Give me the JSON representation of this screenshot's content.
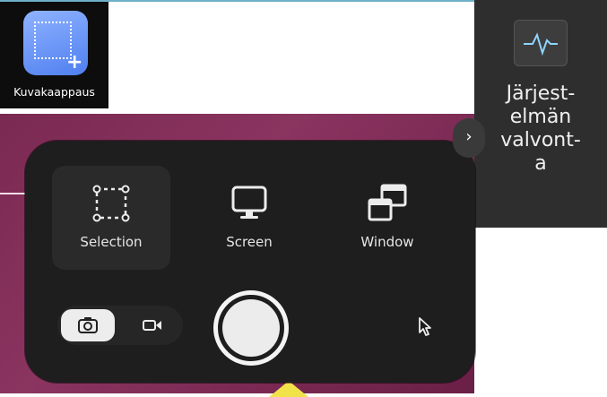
{
  "app_tile": {
    "label": "Kuvakaappaus",
    "icon": "screenshot-app-icon"
  },
  "right_tile": {
    "label": "Järjest-\nelmän\nvalvont-\na",
    "icon": "system-monitor-icon"
  },
  "panel": {
    "modes": [
      {
        "label": "Selection",
        "icon": "selection-icon",
        "active": true
      },
      {
        "label": "Screen",
        "icon": "monitor-icon",
        "active": false
      },
      {
        "label": "Window",
        "icon": "window-icon",
        "active": false
      }
    ],
    "expand_glyph": "›",
    "capture_type": {
      "screenshot_selected": true,
      "screenshot_icon": "camera-icon",
      "screencast_icon": "video-camera-icon"
    },
    "show_pointer_icon": "pointer-icon"
  },
  "colors": {
    "panel_bg": "#1e1e1e",
    "wallpaper": "#7a2a52",
    "accent": "#4f7ff0"
  }
}
